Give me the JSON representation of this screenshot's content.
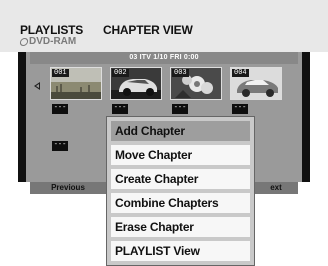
{
  "header": {
    "tab_playlists": "PLAYLISTS",
    "tab_chapter_view": "CHAPTER VIEW",
    "media": "DVD-RAM",
    "media_icon": "disc-icon"
  },
  "info_strip": "03  ITV   1/10  FRI  0:00",
  "chapters": [
    {
      "num": "001",
      "tag": "---",
      "icon": "landscape-thumbnail"
    },
    {
      "num": "002",
      "tag": "---",
      "icon": "car-thumbnail"
    },
    {
      "num": "003",
      "tag": "---",
      "icon": "flower-thumbnail"
    },
    {
      "num": "004",
      "tag": "---",
      "icon": "car-thumbnail"
    },
    {
      "num": "",
      "tag": "---",
      "icon": "empty-slot"
    }
  ],
  "buttons": {
    "previous": "Previous",
    "next": "ext"
  },
  "menu": {
    "items": [
      {
        "label": "Add Chapter",
        "selected": true
      },
      {
        "label": "Move Chapter"
      },
      {
        "label": "Create Chapter"
      },
      {
        "label": "Combine Chapters"
      },
      {
        "label": "Erase Chapter"
      },
      {
        "label": "PLAYLIST View"
      }
    ]
  },
  "colors": {
    "panel": "#9a9a9a",
    "menu_selected": "#9e9e9e",
    "menu_item": "#f7f7f7"
  }
}
